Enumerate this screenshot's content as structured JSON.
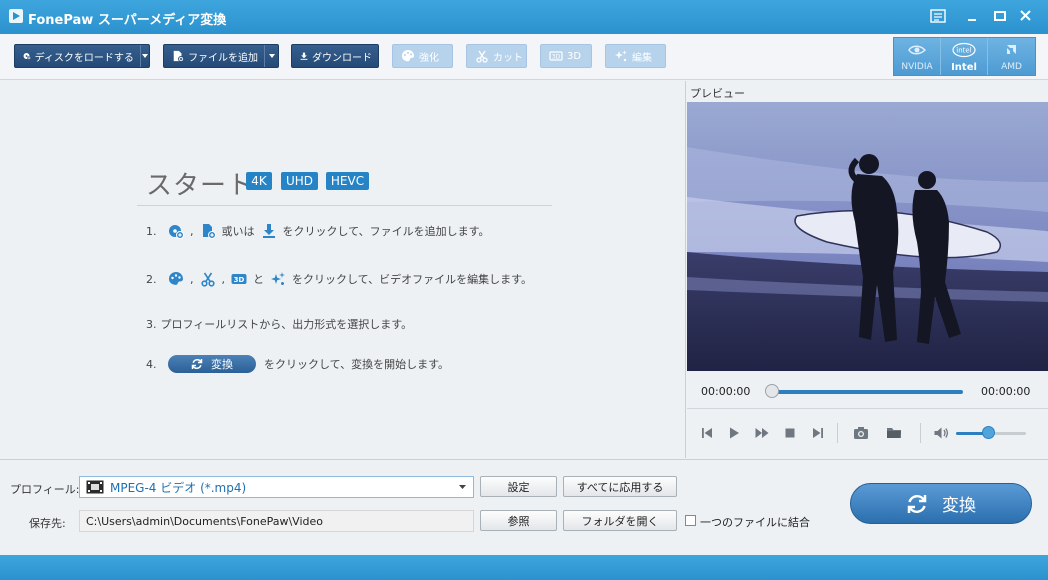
{
  "window": {
    "title": "FonePaw スーパーメディア変換"
  },
  "toolbar": {
    "load_disc": "ディスクをロードする",
    "add_file": "ファイルを追加",
    "download": "ダウンロード",
    "enhance": "強化",
    "cut": "カット",
    "threed": "3D",
    "edit": "編集"
  },
  "gpu": {
    "items": [
      {
        "label": "NVIDIA",
        "logo": "nvidia"
      },
      {
        "label": "Intel",
        "logo": "intel",
        "active": true
      },
      {
        "label": "AMD",
        "logo": "amd"
      }
    ]
  },
  "start": {
    "title": "スタート",
    "badges": [
      "4K",
      "UHD",
      "HEVC"
    ],
    "steps": [
      {
        "num": "1.",
        "sep1": ",",
        "or": "或いは",
        "text": "をクリックして、ファイルを追加します。"
      },
      {
        "num": "2.",
        "sep1": ",",
        "sep2": ",",
        "and": "と",
        "text": "をクリックして、ビデオファイルを編集します。"
      },
      {
        "num": "3.",
        "text": "プロフィールリストから、出力形式を選択します。"
      },
      {
        "num": "4.",
        "button": "変換",
        "text": "をクリックして、変換を開始します。"
      }
    ]
  },
  "preview": {
    "label": "プレビュー",
    "time_current": "00:00:00",
    "time_total": "00:00:00",
    "progress": 0,
    "volume": 0.45
  },
  "bottom": {
    "profile_label": "プロフィール:",
    "profile_value": "MPEG-4 ビデオ (*.mp4)",
    "save_label": "保存先:",
    "save_path": "C:\\Users\\admin\\Documents\\FonePaw\\Video",
    "settings_btn": "設定",
    "apply_all_btn": "すべてに応用する",
    "browse_btn": "参照",
    "open_folder_btn": "フォルダを開く",
    "merge_label": "一つのファイルに結合",
    "convert_btn": "変換"
  },
  "colors": {
    "accent": "#2b92cf",
    "dark_button": "#254a77",
    "badge": "#2683c6"
  }
}
